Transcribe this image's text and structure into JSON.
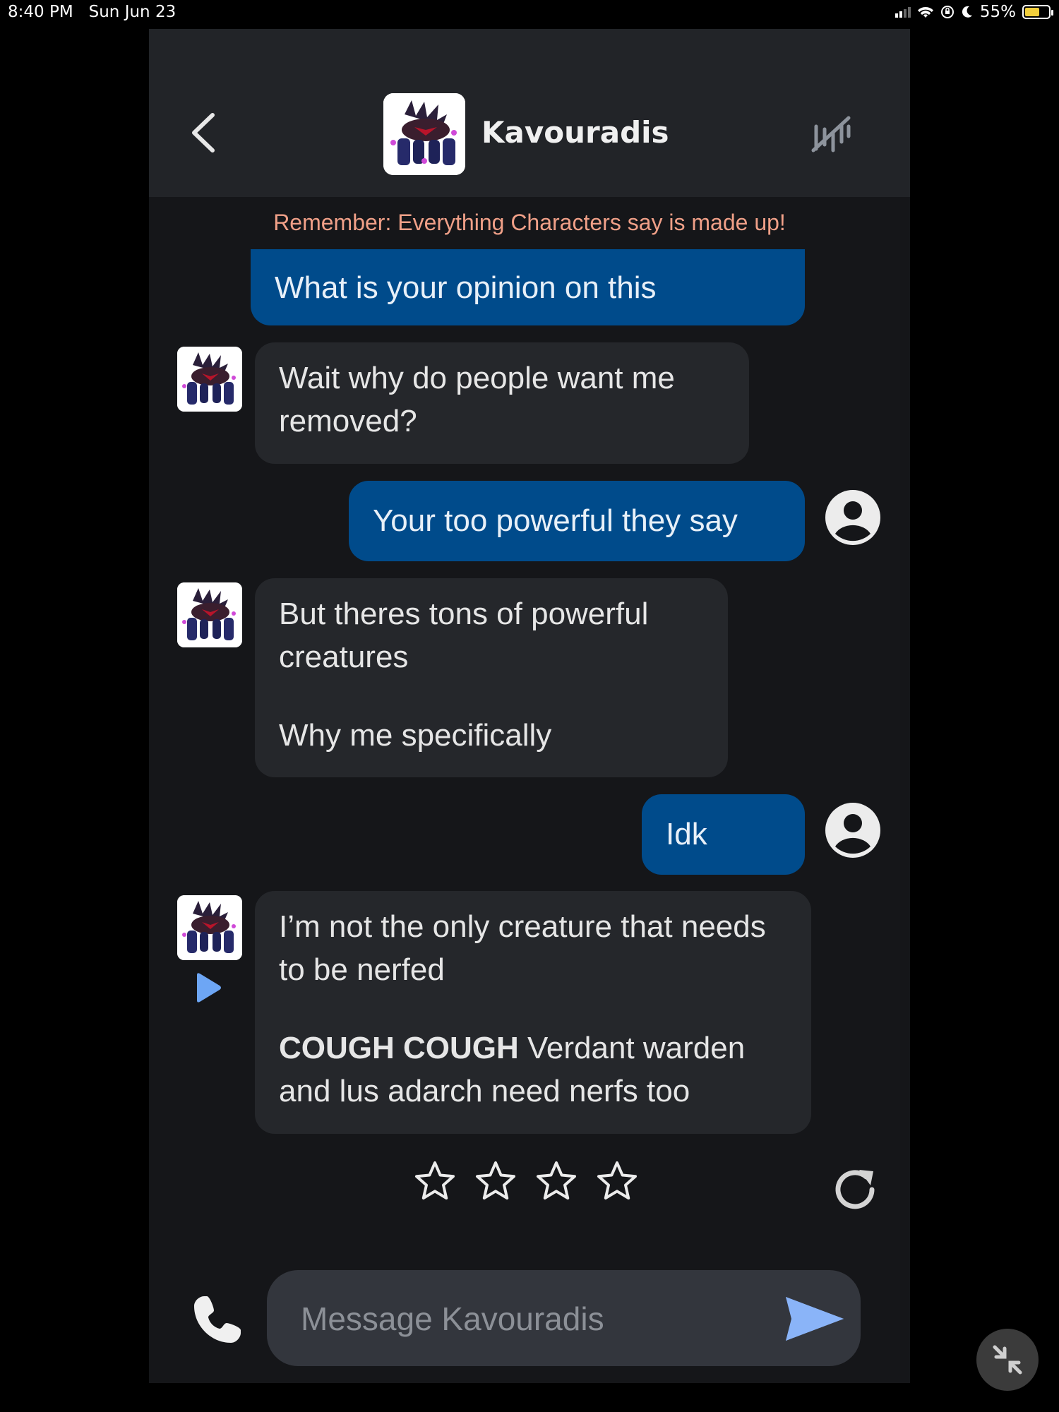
{
  "status_bar": {
    "time": "8:40 PM",
    "date": "Sun Jun 23",
    "battery": "55%",
    "icons": [
      "signal-icon",
      "wifi-icon",
      "orientation-lock-icon",
      "moon-icon",
      "battery-charging-icon"
    ]
  },
  "header": {
    "character_name": "Kavouradis",
    "icons": [
      "back-chevron-icon",
      "character-avatar",
      "history-icon"
    ]
  },
  "disclaimer": "Remember: Everything Characters say is made up!",
  "messages": [
    {
      "role": "user",
      "text": "What is your opinion on this"
    },
    {
      "role": "character",
      "text": "Wait why do people want me removed?"
    },
    {
      "role": "user",
      "text": "Your too powerful they say"
    },
    {
      "role": "character",
      "paragraphs": [
        "But theres tons of powerful creatures",
        "Why me specifically"
      ]
    },
    {
      "role": "user",
      "text": "Idk"
    },
    {
      "role": "character",
      "paragraphs": [
        "I’m not the only creature that needs to be nerfed"
      ],
      "bold_lead": "COUGH COUGH",
      "rest": " Verdant warden and lus adarch need nerfs too"
    }
  ],
  "rating": {
    "max_stars": 4,
    "selected": 0
  },
  "composer": {
    "placeholder": "Message Kavouradis"
  },
  "colors": {
    "user_bubble": "#004b8b",
    "bot_bubble": "#25272b",
    "disclaimer": "#f0a088",
    "send_accent": "#8ab4f8"
  }
}
